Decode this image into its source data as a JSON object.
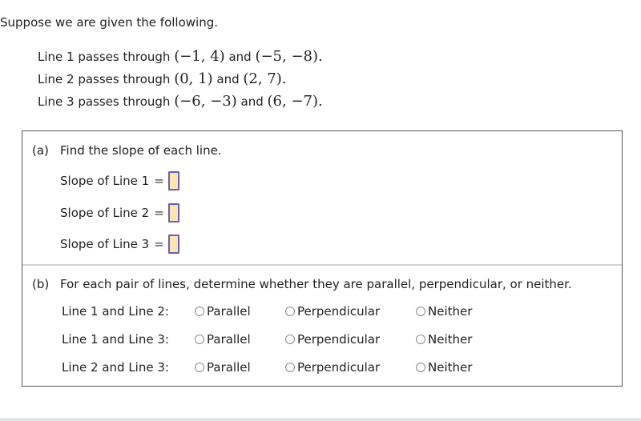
{
  "intro": "Suppose we are given the following.",
  "given": [
    {
      "prefix": "Line 1 passes through ",
      "p1": "(−1, 4)",
      "and": " and ",
      "p2": "(−5, −8)",
      "suffix": "."
    },
    {
      "prefix": "Line 2 passes through ",
      "p1": "(0, 1)",
      "and": " and ",
      "p2": "(2, 7)",
      "suffix": "."
    },
    {
      "prefix": "Line 3 passes through ",
      "p1": "(−6, −3)",
      "and": " and ",
      "p2": "(6, −7)",
      "suffix": "."
    }
  ],
  "part_a": {
    "label": "(a)",
    "text": "Find the slope of each line.",
    "rows": [
      {
        "label": "Slope of Line 1",
        "eq": "=",
        "value": ""
      },
      {
        "label": "Slope of Line 2",
        "eq": "=",
        "value": ""
      },
      {
        "label": "Slope of Line 3",
        "eq": "=",
        "value": ""
      }
    ]
  },
  "part_b": {
    "label": "(b)",
    "text": "For each pair of lines, determine whether they are parallel, perpendicular, or neither.",
    "options": [
      "Parallel",
      "Perpendicular",
      "Neither"
    ],
    "rows": [
      {
        "label": "Line 1 and Line 2:",
        "selected": null
      },
      {
        "label": "Line 1 and Line 3:",
        "selected": null
      },
      {
        "label": "Line 2 and Line 3:",
        "selected": null
      }
    ]
  },
  "colors": {
    "answer_box_fill": "#fbe6ad",
    "answer_box_border": "#6a5fb8",
    "box_border": "#555555"
  }
}
